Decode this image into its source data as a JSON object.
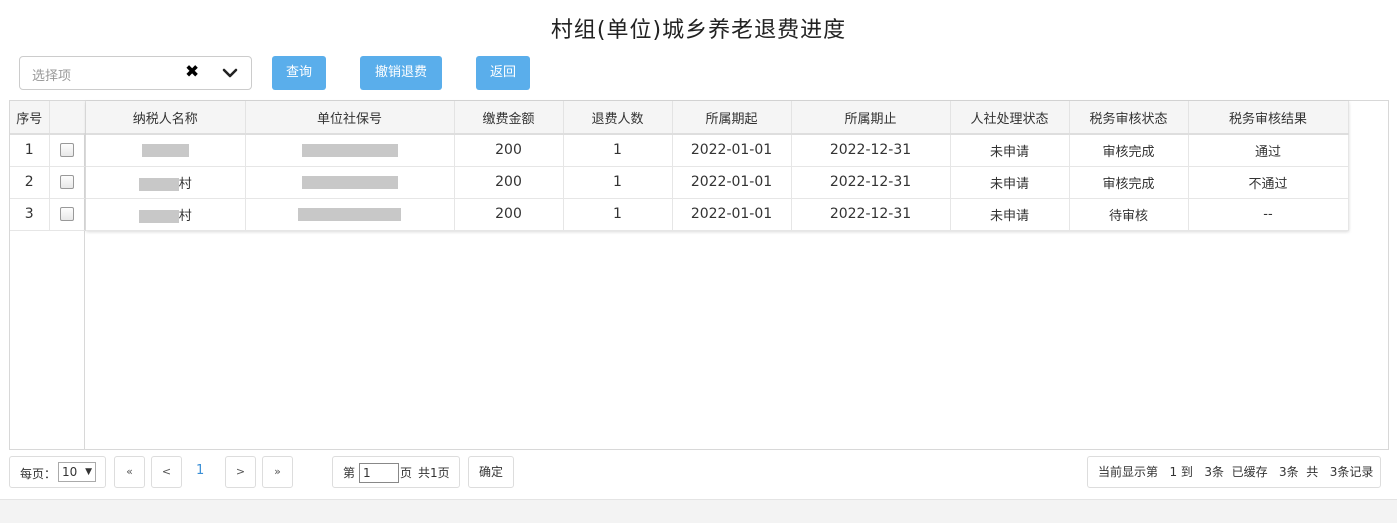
{
  "page": {
    "title": "村组(单位)城乡养老退费进度"
  },
  "toolbar": {
    "select_placeholder": "选择项",
    "clear_icon": "close-icon",
    "dropdown_icon": "chevron-down-icon",
    "query_label": "查询",
    "cancel_refund_label": "撤销退费",
    "back_label": "返回",
    "button_color": "#5aaeeb"
  },
  "table": {
    "frozen_headers": {
      "seq": "序号",
      "check": ""
    },
    "headers": [
      "纳税人名称",
      "单位社保号",
      "缴费金额",
      "退费人数",
      "所属期起",
      "所属期止",
      "人社处理状态",
      "税务审核状态",
      "税务审核结果"
    ],
    "rows": [
      {
        "seq": "1",
        "name": "",
        "social_no": "",
        "amount": "200",
        "refund_count": "1",
        "period_start": "2022-01-01",
        "period_end": "2022-12-31",
        "hr_status": "未申请",
        "tax_status": "审核完成",
        "tax_result": "通过"
      },
      {
        "seq": "2",
        "name": "村",
        "social_no": "",
        "amount": "200",
        "refund_count": "1",
        "period_start": "2022-01-01",
        "period_end": "2022-12-31",
        "hr_status": "未申请",
        "tax_status": "审核完成",
        "tax_result": "不通过"
      },
      {
        "seq": "3",
        "name": "村",
        "social_no": "",
        "amount": "200",
        "refund_count": "1",
        "period_start": "2022-01-01",
        "period_end": "2022-12-31",
        "hr_status": "未申请",
        "tax_status": "待审核",
        "tax_result": "--"
      }
    ],
    "link_color": "#3b8fd6"
  },
  "pager": {
    "per_page_label": "每页：",
    "per_page_value": "10",
    "first": "«",
    "prev": "<",
    "current": "1",
    "next": ">",
    "last": "»",
    "page_prefix": "第",
    "page_input": "1",
    "page_suffix": "页",
    "total_pages": "共1页",
    "confirm_label": "确定",
    "status_text": "当前显示第   1 到   3条  已缓存   3条  共   3条记录"
  }
}
